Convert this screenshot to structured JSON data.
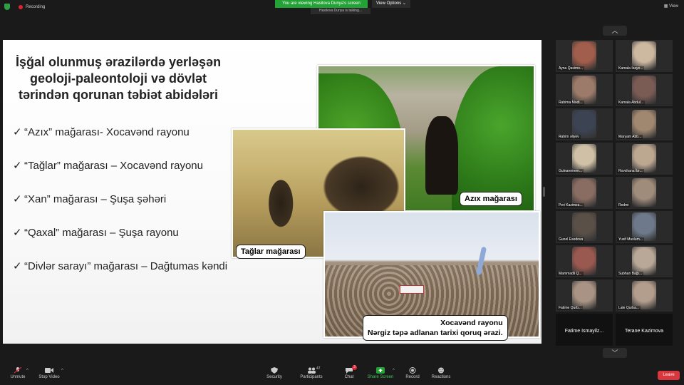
{
  "top_bar": {
    "recording_label": "Recording",
    "banner_text": "You are viewing Hasilova Dunya's screen",
    "sub_banner_text": "Hasilova Dunya is talking...",
    "view_options_label": "View Options",
    "view_label": "View"
  },
  "slide": {
    "title": "İşğal olunmuş ərazilərdə yerləşən geoloji-paleontoloji və dövlət tərindən qorunan təbiət abidələri",
    "bullets": [
      "“Azıx” mağarası- Xocavənd rayonu",
      "“Tağlar” mağarası – Xocavənd rayonu",
      "“Xan” mağarası – Şuşa şəhəri",
      "“Qaxal” mağarası – Şuşa rayonu",
      "“Divlər sarayı” mağarası – Dağtumas kəndi"
    ],
    "check_glyph": "✓",
    "captions": {
      "azix": "Azıx mağarası",
      "taglar": "Tağlar mağarası",
      "xocavend_line1": "Xocavənd rayonu",
      "xocavend_line2": "Nərgiz təpə adlanan tarixi qoruq ərazi."
    }
  },
  "participants": [
    {
      "name": "Ayna Qasimo...",
      "face": "#a25e4c"
    },
    {
      "name": "Kamala Isaye...",
      "face": "#cdb8a0"
    },
    {
      "name": "Rahima Mədi...",
      "face": "#9c7b6a"
    },
    {
      "name": "Kamala Abdul...",
      "face": "#7b5c55"
    },
    {
      "name": "Rahim əliyev",
      "face": "#3c4454"
    },
    {
      "name": "Maryam Abb...",
      "face": "#a08770"
    },
    {
      "name": "Gulnaremem...",
      "face": "#cfc0a6"
    },
    {
      "name": "Rovshana İbr...",
      "face": "#bca791"
    },
    {
      "name": "Peri Kazimza...",
      "face": "#8a6d62"
    },
    {
      "name": "Redmi",
      "face": "#a08c7b"
    },
    {
      "name": "Gunel Esedova",
      "face": "#5b5048"
    },
    {
      "name": "Yusif Muslum...",
      "face": "#6e7a8b"
    },
    {
      "name": "Mammadli Q...",
      "face": "#9a5950"
    },
    {
      "name": "Subhan Bağı...",
      "face": "#b9a897"
    },
    {
      "name": "Fatime Qurb...",
      "face": "#a89384"
    },
    {
      "name": "Lale Qurba...",
      "face": "#b39d8c"
    },
    {
      "name": "Fatime  Ismayilz...",
      "face": ""
    },
    {
      "name": "Terane Kazimova",
      "face": ""
    }
  ],
  "toolbar": {
    "unmute": "Unmute",
    "stop_video": "Stop Video",
    "security": "Security",
    "participants": "Participants",
    "participants_count": "47",
    "chat": "Chat",
    "chat_badge": "3",
    "share_screen": "Share Screen",
    "record": "Record",
    "reactions": "Reactions",
    "leave": "Leave"
  },
  "colors": {
    "share_green": "#23a335",
    "leave_red": "#d9363e",
    "background": "#1a1a1a"
  }
}
